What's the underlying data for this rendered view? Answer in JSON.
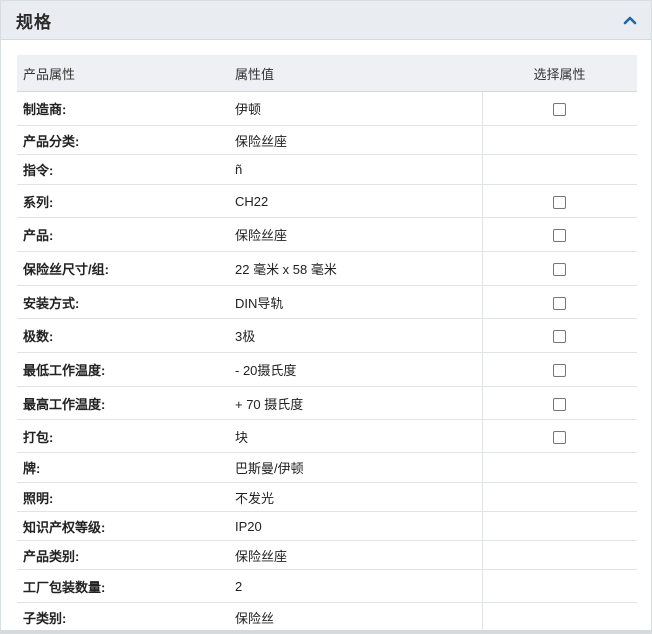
{
  "panel": {
    "title": "规格"
  },
  "table": {
    "headers": [
      "产品属性",
      "属性值",
      "选择属性"
    ],
    "rows": [
      {
        "name": "制造商:",
        "value": "伊顿",
        "checkbox": true,
        "link_name": false,
        "link_value": false
      },
      {
        "name": "产品分类:",
        "value": "保险丝座",
        "checkbox": false,
        "link_name": false,
        "link_value": false
      },
      {
        "name": "指令:",
        "value": "ñ",
        "checkbox": false,
        "link_name": false,
        "link_value": false
      },
      {
        "name": "系列:",
        "value": "CH22",
        "checkbox": true,
        "link_name": false,
        "link_value": true
      },
      {
        "name": "产品:",
        "value": "保险丝座",
        "checkbox": true,
        "link_name": false,
        "link_value": false
      },
      {
        "name": "保险丝尺寸/组:",
        "value": "22 毫米 x 58 毫米",
        "checkbox": true,
        "link_name": false,
        "link_value": false
      },
      {
        "name": "安装方式:",
        "value": "DIN导轨",
        "checkbox": true,
        "link_name": false,
        "link_value": false
      },
      {
        "name": "极数:",
        "value": "3极",
        "checkbox": true,
        "link_name": false,
        "link_value": false
      },
      {
        "name": "最低工作温度:",
        "value": "- 20摄氏度",
        "checkbox": true,
        "link_name": false,
        "link_value": false
      },
      {
        "name": "最高工作温度:",
        "value": "+ 70 摄氏度",
        "checkbox": true,
        "link_name": false,
        "link_value": false
      },
      {
        "name": "打包:",
        "value": "块",
        "checkbox": true,
        "link_name": false,
        "link_value": false
      },
      {
        "name": "牌:",
        "value": "巴斯曼/伊顿",
        "checkbox": false,
        "link_name": false,
        "link_value": false
      },
      {
        "name": "照明:",
        "value": "不发光",
        "checkbox": false,
        "link_name": false,
        "link_value": false
      },
      {
        "name": "知识产权等级:",
        "value": "IP20",
        "checkbox": false,
        "link_name": false,
        "link_value": false
      },
      {
        "name": "产品类别:",
        "value": "保险丝座",
        "checkbox": false,
        "link_name": false,
        "link_value": false
      },
      {
        "name": "工厂包装数量:",
        "value": "2",
        "checkbox": false,
        "link_name": true,
        "link_value": false
      },
      {
        "name": "子类别:",
        "value": "保险丝",
        "checkbox": false,
        "link_name": false,
        "link_value": false
      }
    ]
  },
  "colors": {
    "link": "#1a6aa8",
    "header_bg": "#e9edf1",
    "caret": "#1a6aa8"
  },
  "icons": {
    "collapse": "chevron-up-icon"
  }
}
